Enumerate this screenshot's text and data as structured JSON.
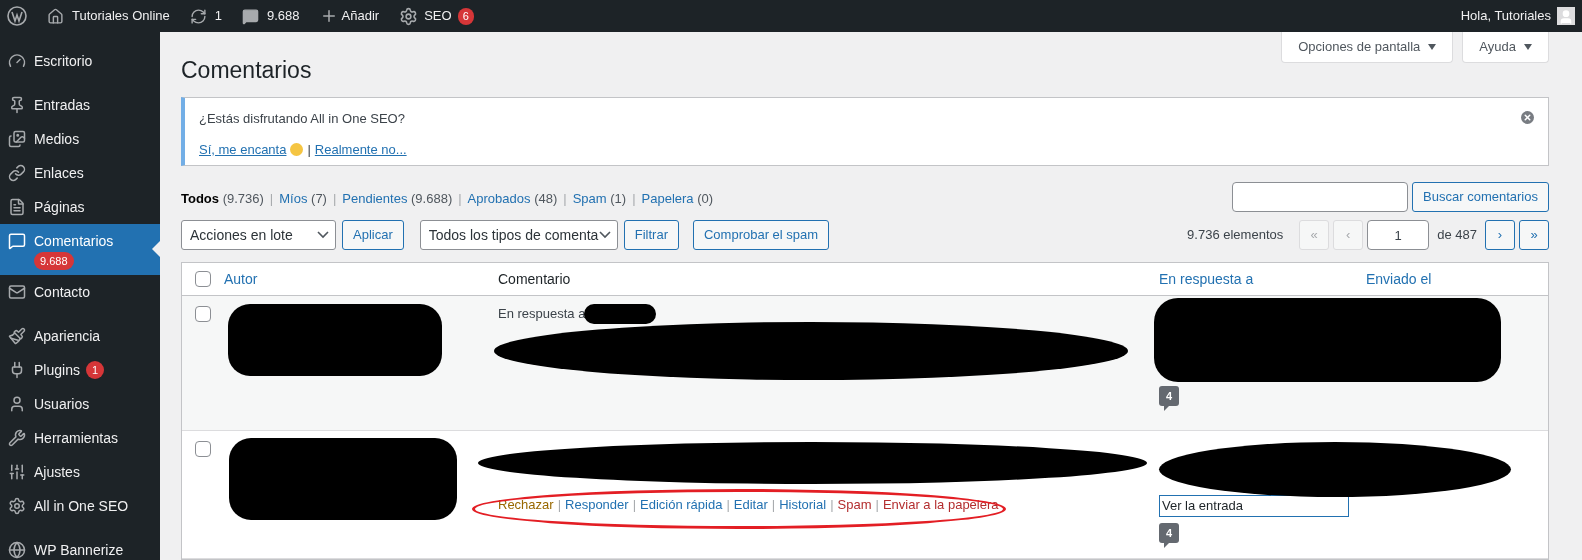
{
  "admin_bar": {
    "site": "Tutoriales Online",
    "updates": "1",
    "comments": "9.688",
    "new": "Añadir",
    "seo": "SEO",
    "seo_badge": "6",
    "greeting": "Hola, Tutoriales"
  },
  "sidebar": {
    "groups": [
      [
        {
          "label": "Escritorio",
          "kind": "dashboard",
          "selected": false
        }
      ],
      [
        {
          "label": "Entradas",
          "kind": "pin",
          "selected": false
        },
        {
          "label": "Medios",
          "kind": "media",
          "selected": false
        },
        {
          "label": "Enlaces",
          "kind": "link",
          "selected": false
        },
        {
          "label": "Páginas",
          "kind": "pages",
          "selected": false
        },
        {
          "label": "Comentarios",
          "kind": "comment",
          "selected": true,
          "badge": "9.688"
        },
        {
          "label": "Contacto",
          "kind": "mail",
          "selected": false
        }
      ],
      [
        {
          "label": "Apariencia",
          "kind": "brush",
          "selected": false
        },
        {
          "label": "Plugins",
          "kind": "plug",
          "selected": false,
          "badge": "1"
        },
        {
          "label": "Usuarios",
          "kind": "user",
          "selected": false
        },
        {
          "label": "Herramientas",
          "kind": "wrench",
          "selected": false
        },
        {
          "label": "Ajustes",
          "kind": "sliders",
          "selected": false
        },
        {
          "label": "All in One SEO",
          "kind": "gear",
          "selected": false
        }
      ],
      [
        {
          "label": "WP Bannerize",
          "kind": "globe",
          "selected": false
        }
      ]
    ]
  },
  "screen_options": [
    "Opciones de pantalla",
    "Ayuda"
  ],
  "title": "Comentarios",
  "notice": {
    "question": "¿Estás disfrutando All in One SEO?",
    "yes": "Sí, me encanta",
    "separator": "|",
    "no": "Realmente no..."
  },
  "views_separator": "|",
  "views": [
    {
      "label": "Todos",
      "count": "(9.736)",
      "selected": true
    },
    {
      "label": "Míos",
      "count": "(7)",
      "selected": false
    },
    {
      "label": "Pendientes",
      "count": "(9.688)",
      "selected": false
    },
    {
      "label": "Aprobados",
      "count": "(48)",
      "selected": false
    },
    {
      "label": "Spam",
      "count": "(1)",
      "selected": false
    },
    {
      "label": "Papelera",
      "count": "(0)",
      "selected": false
    }
  ],
  "search_button": "Buscar comentarios",
  "bulk_select": "Acciones en lote",
  "apply": "Aplicar",
  "type_select": "Todos los tipos de comenta",
  "filter": "Filtrar",
  "check_spam": "Comprobar el spam",
  "pagination": {
    "count": "9.736 elementos",
    "buttons_before": [
      {
        "label": "«",
        "disabled": true
      },
      {
        "label": "‹",
        "disabled": true
      }
    ],
    "page": "1",
    "of": "de 487",
    "buttons_after": [
      {
        "label": "›",
        "disabled": false
      },
      {
        "label": "»",
        "disabled": false
      }
    ]
  },
  "table": {
    "select_all_checked": false,
    "columns": [
      "Autor",
      "Comentario",
      "En respuesta a",
      "Enviado el"
    ],
    "rows": [
      {
        "checked": false,
        "reply_prefix": "En respuesta a",
        "bubble": "4"
      },
      {
        "checked": false,
        "actions_separator": "|",
        "actions": [
          {
            "label": "Rechazar",
            "kind": "unapprove"
          },
          {
            "label": "Responder",
            "kind": "normal"
          },
          {
            "label": "Edición rápida",
            "kind": "normal"
          },
          {
            "label": "Editar",
            "kind": "normal"
          },
          {
            "label": "Historial",
            "kind": "normal"
          },
          {
            "label": "Spam",
            "kind": "delete"
          },
          {
            "label": "Enviar a la papelera",
            "kind": "delete"
          }
        ],
        "view_post": "Ver la entrada",
        "bubble": "4"
      }
    ]
  }
}
